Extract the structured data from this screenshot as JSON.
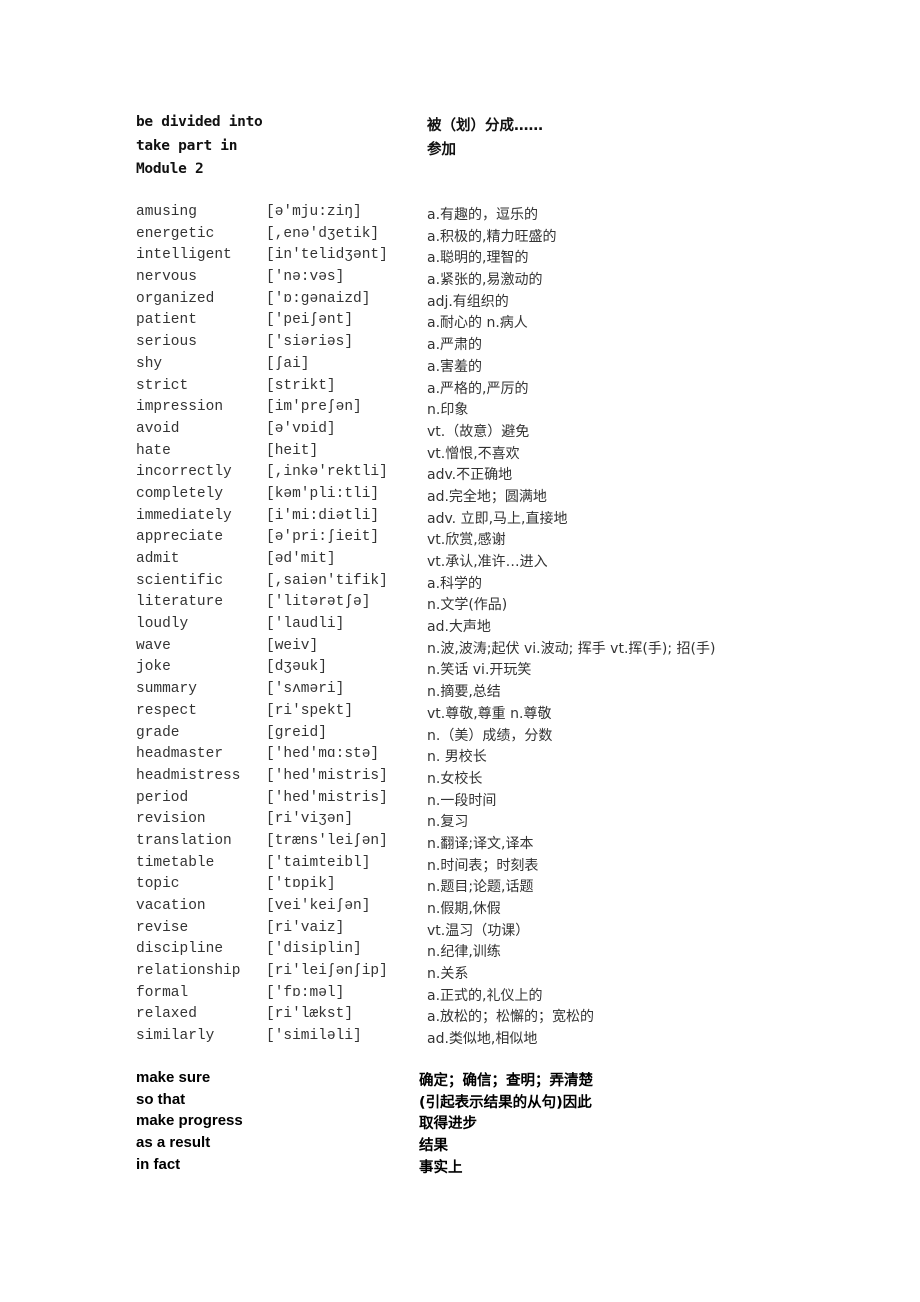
{
  "top_phrases": [
    {
      "en": "be divided into",
      "zh": "被（划）分成……"
    },
    {
      "en": "take part in",
      "zh": "参加"
    }
  ],
  "module_heading": "Module 2",
  "vocabulary": [
    {
      "word": "amusing",
      "phonetic": "[ə'mju:ziŋ]",
      "meaning": "a.有趣的，逗乐的"
    },
    {
      "word": "energetic",
      "phonetic": "[,enə'dʒetik]",
      "meaning": "a.积极的,精力旺盛的"
    },
    {
      "word": "intelligent",
      "phonetic": "[in'telidʒənt]",
      "meaning": "a.聪明的,理智的"
    },
    {
      "word": "nervous",
      "phonetic": "['nə:vəs]",
      "meaning": "a.紧张的,易激动的"
    },
    {
      "word": "organized",
      "phonetic": "['ɒ:gənaizd]",
      "meaning": "adj.有组织的"
    },
    {
      "word": "patient",
      "phonetic": "['peiʃənt]",
      "meaning": "a.耐心的 n.病人"
    },
    {
      "word": "serious",
      "phonetic": "['siəriəs]",
      "meaning": "a.严肃的"
    },
    {
      "word": "shy",
      "phonetic": "[ʃai]",
      "meaning": "a.害羞的"
    },
    {
      "word": "strict",
      "phonetic": "[strikt]",
      "meaning": "a.严格的,严厉的"
    },
    {
      "word": "impression",
      "phonetic": "[im'preʃən]",
      "meaning": "n.印象"
    },
    {
      "word": "avoid",
      "phonetic": "[ə'vɒid]",
      "meaning": "vt.（故意）避免"
    },
    {
      "word": "hate",
      "phonetic": "[heit]",
      "meaning": "vt.憎恨,不喜欢"
    },
    {
      "word": "incorrectly",
      "phonetic": "[,inkə'rektli]",
      "meaning": "adv.不正确地"
    },
    {
      "word": "completely",
      "phonetic": "[kəm'pli:tli]",
      "meaning": "ad.完全地；圆满地"
    },
    {
      "word": "immediately",
      "phonetic": "[i'mi:diətli]",
      "meaning": "adv. 立即,马上,直接地"
    },
    {
      "word": "appreciate",
      "phonetic": "[ə'pri:ʃieit]",
      "meaning": "vt.欣赏,感谢"
    },
    {
      "word": "admit",
      "phonetic": "[əd'mit]",
      "meaning": "vt.承认,准许…进入"
    },
    {
      "word": "scientific",
      "phonetic": "[,saiən'tifik]",
      "meaning": "a.科学的"
    },
    {
      "word": "literature",
      "phonetic": "['litərətʃə]",
      "meaning": "n.文学(作品)"
    },
    {
      "word": "loudly",
      "phonetic": "['laudli]",
      "meaning": "ad.大声地"
    },
    {
      "word": "wave",
      "phonetic": "[weiv]",
      "meaning": "n.波,波涛;起伏 vi.波动; 挥手 vt.挥(手); 招(手)"
    },
    {
      "word": "joke",
      "phonetic": "[dʒəuk]",
      "meaning": "n.笑话 vi.开玩笑"
    },
    {
      "word": "summary",
      "phonetic": "['sʌməri]",
      "meaning": "n.摘要,总结"
    },
    {
      "word": "respect",
      "phonetic": "[ri'spekt]",
      "meaning": "vt.尊敬,尊重 n.尊敬"
    },
    {
      "word": "grade",
      "phonetic": "[greid]",
      "meaning": "n.（美）成绩，分数"
    },
    {
      "word": "headmaster",
      "phonetic": "['hed'mɑ:stə]",
      "meaning": "n. 男校长"
    },
    {
      "word": "headmistress",
      "phonetic": "['hed'mistris]",
      "meaning": "n.女校长"
    },
    {
      "word": "period",
      "phonetic": "['hed'mistris]",
      "meaning": "n.一段时间"
    },
    {
      "word": "revision",
      "phonetic": "[ri'viʒən]",
      "meaning": "n.复习"
    },
    {
      "word": "translation",
      "phonetic": "[træns'leiʃən]",
      "meaning": "n.翻译;译文,译本"
    },
    {
      "word": "timetable",
      "phonetic": "['taimteibl]",
      "meaning": "n.时间表；时刻表"
    },
    {
      "word": "topic",
      "phonetic": "['tɒpik]",
      "meaning": "n.题目;论题,话题"
    },
    {
      "word": "vacation",
      "phonetic": "[vei'keiʃən]",
      "meaning": "n.假期,休假"
    },
    {
      "word": "revise",
      "phonetic": "[ri'vaiz]",
      "meaning": "vt.温习（功课）"
    },
    {
      "word": "discipline",
      "phonetic": "['disiplin]",
      "meaning": "n.纪律,训练"
    },
    {
      "word": "relationship",
      "phonetic": "[ri'leiʃənʃip]",
      "meaning": "n.关系"
    },
    {
      "word": "formal",
      "phonetic": "['fɒ:məl]",
      "meaning": "a.正式的,礼仪上的"
    },
    {
      "word": "relaxed",
      "phonetic": "[ri'lækst]",
      "meaning": "a.放松的；松懈的；宽松的"
    },
    {
      "word": "similarly",
      "phonetic": "['similəli]",
      "meaning": "ad.类似地,相似地"
    }
  ],
  "bottom_phrases": [
    {
      "en": "make sure",
      "zh": "确定；确信；查明；弄清楚"
    },
    {
      "en": "so that",
      "zh": "(引起表示结果的从句)因此"
    },
    {
      "en": "make progress",
      "zh": "取得进步"
    },
    {
      "en": "as a result",
      "zh": "结果"
    },
    {
      "en": "in fact",
      "zh": "事实上"
    }
  ]
}
